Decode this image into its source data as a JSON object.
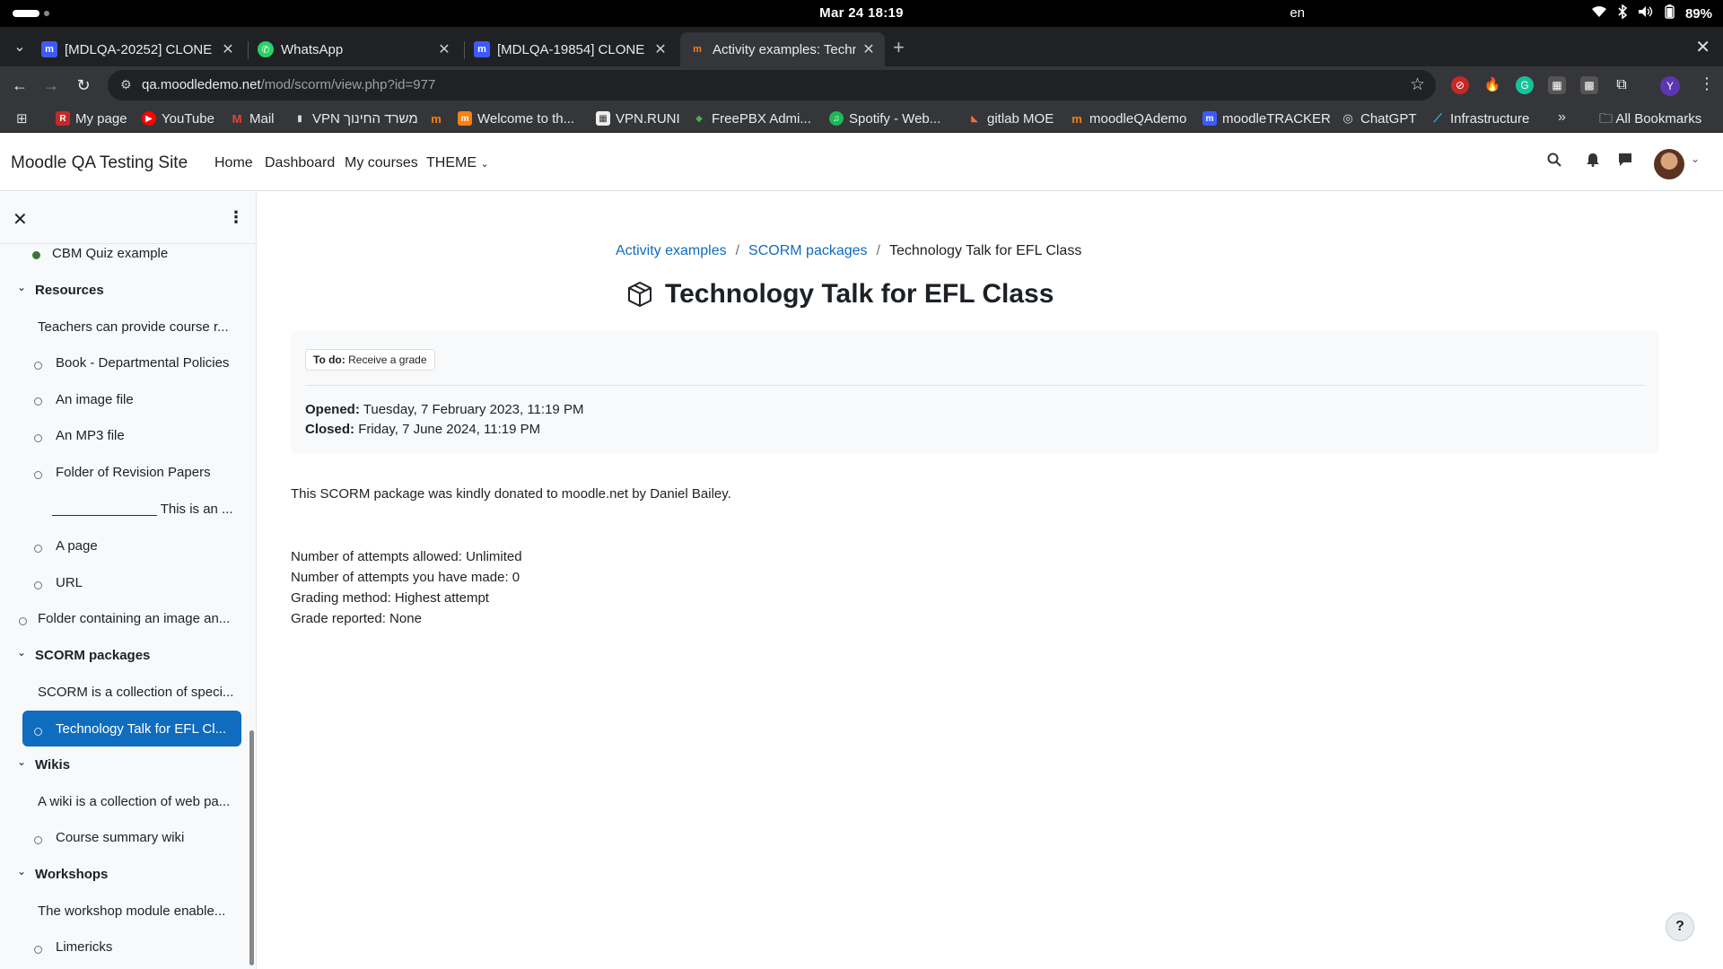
{
  "os": {
    "clock": "Mar 24  18:19",
    "lang": "en",
    "battery": "89%"
  },
  "tabs": [
    {
      "title": "[MDLQA-20252] CLONE",
      "favicon": "moodle-tracker-icon",
      "active": false
    },
    {
      "title": "WhatsApp",
      "favicon": "whatsapp-icon",
      "active": false
    },
    {
      "title": "[MDLQA-19854] CLONE",
      "favicon": "moodle-tracker-icon",
      "active": false
    },
    {
      "title": "Activity examples: Techn",
      "favicon": "moodle-icon",
      "active": true
    }
  ],
  "address": {
    "host": "qa.moodledemo.net",
    "path": "/mod/scorm/view.php?id=977"
  },
  "profile_initial": "Y",
  "bookmarks": [
    {
      "label": "My page",
      "icon": "R"
    },
    {
      "label": "YouTube",
      "icon": "▶"
    },
    {
      "label": "Mail",
      "icon": "M"
    },
    {
      "label": "VPN משרד החינוך",
      "icon": "▮"
    },
    {
      "label": "",
      "icon": "m"
    },
    {
      "label": "Welcome to th...",
      "icon": "m"
    },
    {
      "label": "VPN.RUNI",
      "icon": "▦"
    },
    {
      "label": "FreePBX Admi...",
      "icon": "◆"
    },
    {
      "label": "Spotify - Web...",
      "icon": "♫"
    },
    {
      "label": "gitlab MOE",
      "icon": "◣"
    },
    {
      "label": "moodleQAdemo",
      "icon": "m"
    },
    {
      "label": "moodleTRACKER",
      "icon": "m"
    },
    {
      "label": "ChatGPT",
      "icon": "◎"
    },
    {
      "label": "Infrastructure",
      "icon": "⟋"
    }
  ],
  "bookmarks_all": "All Bookmarks",
  "navbar": {
    "brand": "Moodle QA Testing Site",
    "links": [
      "Home",
      "Dashboard",
      "My courses",
      "THEME"
    ]
  },
  "drawer": {
    "items": [
      {
        "label": "CBM Quiz example",
        "kind": "activity",
        "done": true
      },
      {
        "label": "Resources",
        "kind": "section"
      },
      {
        "label": "Teachers can provide course r...",
        "kind": "label"
      },
      {
        "label": "Book - Departmental Policies",
        "kind": "activity"
      },
      {
        "label": "An image file",
        "kind": "activity"
      },
      {
        "label": "An MP3 file",
        "kind": "activity"
      },
      {
        "label": "Folder of Revision Papers",
        "kind": "activity"
      },
      {
        "label": "______________ This is an ...",
        "kind": "label-indent"
      },
      {
        "label": "A page",
        "kind": "activity"
      },
      {
        "label": "URL",
        "kind": "activity"
      },
      {
        "label": "Folder containing an image an...",
        "kind": "activity-outdent"
      },
      {
        "label": "SCORM packages",
        "kind": "section"
      },
      {
        "label": "SCORM is a collection of speci...",
        "kind": "label"
      },
      {
        "label": "Technology Talk for EFL Cl...",
        "kind": "active"
      },
      {
        "label": "Wikis",
        "kind": "section"
      },
      {
        "label": "A wiki is a collection of web pa...",
        "kind": "label"
      },
      {
        "label": "Course summary wiki",
        "kind": "activity"
      },
      {
        "label": "Workshops",
        "kind": "section"
      },
      {
        "label": "The workshop module enable...",
        "kind": "label"
      },
      {
        "label": "Limericks",
        "kind": "activity"
      }
    ]
  },
  "breadcrumb": [
    "Activity examples",
    "SCORM packages",
    "Technology Talk for EFL Class"
  ],
  "page_title": "Technology Talk for EFL Class",
  "activity_info": {
    "todo_label": "To do:",
    "todo_value": "Receive a grade",
    "opened_label": "Opened:",
    "opened_value": "Tuesday, 7 February 2023, 11:19 PM",
    "closed_label": "Closed:",
    "closed_value": "Friday, 7 June 2024, 11:19 PM"
  },
  "intro": "This SCORM package was kindly donated to moodle.net by Daniel Bailey.",
  "stats": [
    "Number of attempts allowed: Unlimited",
    "Number of attempts you have made: 0",
    "Grading method: Highest attempt",
    "Grade reported: None"
  ],
  "help_label": "?"
}
